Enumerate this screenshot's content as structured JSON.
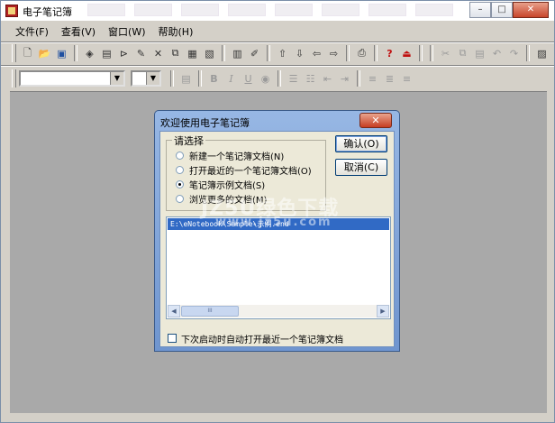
{
  "window": {
    "title": "电子笔记簿",
    "minimize_glyph": "–",
    "restore_glyph": "□",
    "close_glyph": "✕"
  },
  "menu": {
    "items": [
      "文件(F)",
      "查看(V)",
      "窗口(W)",
      "帮助(H)"
    ]
  },
  "toolbar1": {
    "icons": [
      "new-document-icon",
      "open-folder-icon",
      "save-icon",
      "book-icon",
      "notebook-icon",
      "cut-icon",
      "pen-icon",
      "close-icon",
      "copy-icon",
      "paste-icon",
      "page-icon",
      "export-icon",
      "edit-icon",
      "up-arrow-icon",
      "down-arrow-icon",
      "left-arrow-icon",
      "right-arrow-icon",
      "print-icon",
      "help-icon",
      "exit-icon",
      "scissors-icon",
      "copy2-icon",
      "paste2-icon",
      "undo-icon",
      "redo-icon",
      "image-icon",
      "anchor-icon",
      "grid-icon"
    ]
  },
  "toolbar2": {
    "font_value": "",
    "size_value": "",
    "format_buttons": {
      "bold": "B",
      "italic": "I",
      "underline": "U"
    }
  },
  "dialog": {
    "title": "欢迎使用电子笔记簿",
    "close_glyph": "✕",
    "group_label": "请选择",
    "options": [
      {
        "label": "新建一个笔记簿文档(N)",
        "checked": false
      },
      {
        "label": "打开最近的一个笔记簿文档(O)",
        "checked": false
      },
      {
        "label": "笔记簿示例文档(S)",
        "checked": true
      },
      {
        "label": "浏览更多的文档(M)",
        "checked": false
      }
    ],
    "ok_label": "确认(O)",
    "cancel_label": "取消(C)",
    "file_list": [
      "E:\\eNotebook\\Sample\\示例.end"
    ],
    "scroll_thumb_glyph": "III",
    "scroll_left_glyph": "◀",
    "scroll_right_glyph": "▶",
    "checkbox_label": "下次启动时自动打开最近一个笔记簿文档",
    "checkbox_checked": false
  },
  "watermark": {
    "text": "JZ5U绿色下载",
    "sub": "www.jz5u.com"
  }
}
